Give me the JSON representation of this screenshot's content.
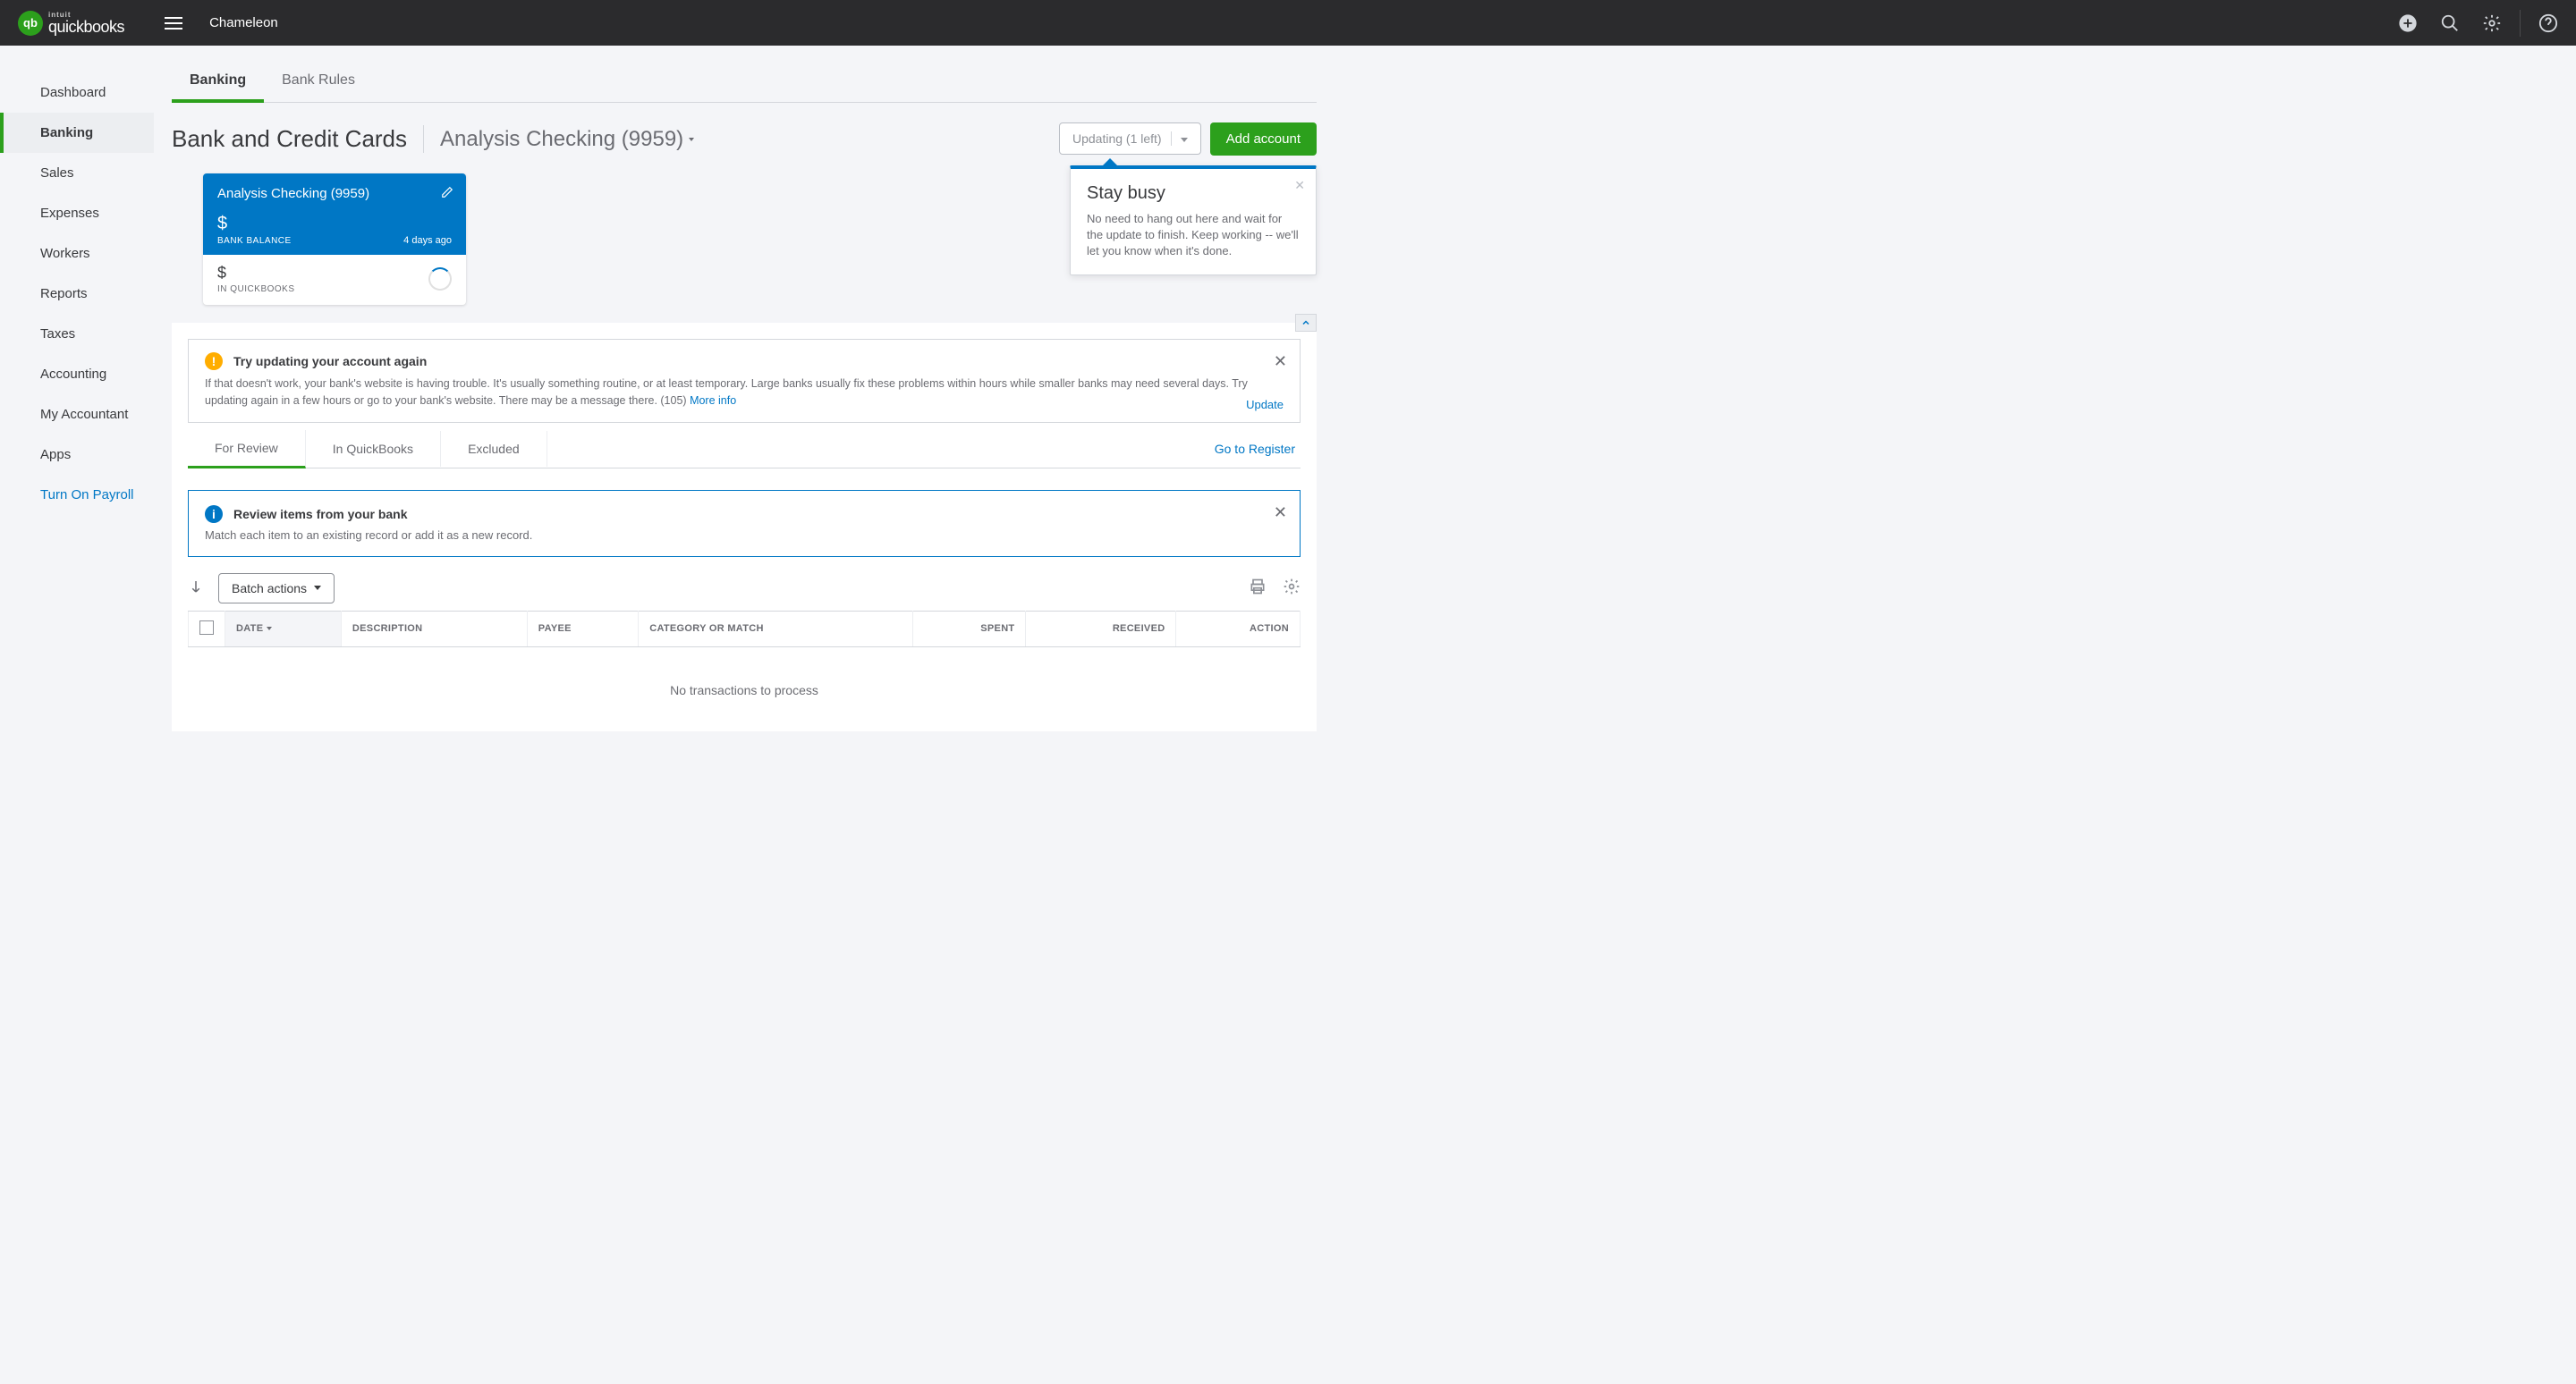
{
  "header": {
    "company": "Chameleon",
    "brand_small": "intuit",
    "brand": "quickbooks"
  },
  "sidebar": {
    "items": [
      {
        "label": "Dashboard"
      },
      {
        "label": "Banking"
      },
      {
        "label": "Sales"
      },
      {
        "label": "Expenses"
      },
      {
        "label": "Workers"
      },
      {
        "label": "Reports"
      },
      {
        "label": "Taxes"
      },
      {
        "label": "Accounting"
      },
      {
        "label": "My Accountant"
      },
      {
        "label": "Apps"
      },
      {
        "label": "Turn On Payroll"
      }
    ]
  },
  "tabs": {
    "banking": "Banking",
    "rules": "Bank Rules"
  },
  "page": {
    "title": "Bank and Credit Cards",
    "account": "Analysis Checking (9959)",
    "update_label": "Updating (1 left)",
    "add_label": "Add account"
  },
  "card": {
    "name": "Analysis Checking (9959)",
    "bank_currency": "$",
    "bank_label": "BANK BALANCE",
    "ago": "4 days ago",
    "qb_currency": "$",
    "qb_label": "IN QUICKBOOKS"
  },
  "tooltip": {
    "title": "Stay busy",
    "text": "No need to hang out here and wait for the update to finish. Keep working -- we'll let you know when it's done."
  },
  "alert": {
    "title": "Try updating your account again",
    "body": "If that doesn't work, your bank's website is having trouble. It's usually something routine, or at least temporary. Large banks usually fix these problems within hours while smaller banks may need several days. Try updating again in a few hours or go to your bank's website. There may be a message there.  (105) ",
    "more": "More info",
    "update": "Update"
  },
  "subtabs": {
    "review": "For Review",
    "inqb": "In QuickBooks",
    "excluded": "Excluded",
    "register": "Go to Register"
  },
  "review_box": {
    "title": "Review items from your bank",
    "body": "Match each item to an existing record or add it as a new record."
  },
  "batch_label": "Batch actions",
  "columns": {
    "date": "DATE",
    "desc": "DESCRIPTION",
    "payee": "PAYEE",
    "cat": "CATEGORY OR MATCH",
    "spent": "SPENT",
    "received": "RECEIVED",
    "action": "ACTION"
  },
  "empty": "No transactions to process"
}
